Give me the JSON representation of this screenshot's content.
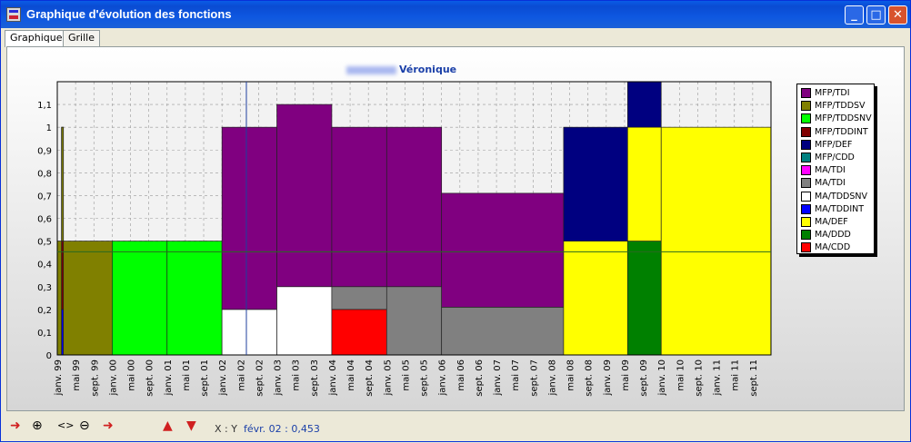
{
  "window": {
    "title": "Graphique d'évolution des fonctions"
  },
  "tabs": [
    "Graphique",
    "Grille"
  ],
  "chart_title": "Véronique",
  "chart_data": {
    "type": "area",
    "y_ticks": [
      "0",
      "0,1",
      "0,2",
      "0,3",
      "0,4",
      "0,5",
      "0,6",
      "0,7",
      "0,8",
      "0,9",
      "1",
      "1,1"
    ],
    "x_ticks": [
      "janv. 99",
      "mai 99",
      "sept. 99",
      "janv. 00",
      "mai 00",
      "sept. 00",
      "janv. 01",
      "mai 01",
      "sept. 01",
      "janv. 02",
      "mai 02",
      "sept. 02",
      "janv. 03",
      "mai 03",
      "sept. 03",
      "janv. 04",
      "mai 04",
      "sept. 04",
      "janv. 05",
      "mai 05",
      "sept. 05",
      "janv. 06",
      "mai 06",
      "sept. 06",
      "janv. 07",
      "mai 07",
      "sept. 07",
      "janv. 08",
      "mai 08",
      "sept. 08",
      "janv. 09",
      "mai 09",
      "sept. 09",
      "janv. 10",
      "mai 10",
      "sept. 10",
      "janv. 11",
      "mai 11",
      "sept. 11"
    ],
    "ylim": [
      0,
      1.2
    ],
    "series": [
      {
        "name": "MFP/TDI",
        "color": "#800080"
      },
      {
        "name": "MFP/TDDSV",
        "color": "#808000"
      },
      {
        "name": "MFP/TDDSNV",
        "color": "#00ff00"
      },
      {
        "name": "MFP/TDDINT",
        "color": "#800000"
      },
      {
        "name": "MFP/DEF",
        "color": "#000080"
      },
      {
        "name": "MFP/CDD",
        "color": "#008080"
      },
      {
        "name": "MA/TDI",
        "color": "#ff00ff"
      },
      {
        "name": "MA/TDI",
        "color": "#808080"
      },
      {
        "name": "MA/TDDSNV",
        "color": "#ffffff"
      },
      {
        "name": "MA/TDDINT",
        "color": "#0000ff"
      },
      {
        "name": "MA/DEF",
        "color": "#ffff00"
      },
      {
        "name": "MA/DDD",
        "color": "#008000"
      },
      {
        "name": "MA/CDD",
        "color": "#ff0000"
      }
    ],
    "segments": [
      {
        "x0": 0,
        "x1": 0.7,
        "stack": [
          {
            "c": 1,
            "v": 0.5
          }
        ]
      },
      {
        "x0": 0.7,
        "x1": 1.0,
        "stack": [
          {
            "c": 9,
            "v": 0.2
          },
          {
            "c": 3,
            "v": 0.3
          },
          {
            "c": 1,
            "v": 0.5
          }
        ]
      },
      {
        "x0": 1.0,
        "x1": 9.0,
        "stack": [
          {
            "c": 1,
            "v": 0.5
          }
        ]
      },
      {
        "x0": 9.0,
        "x1": 18.0,
        "stack": [
          {
            "c": 2,
            "v": 0.5
          }
        ]
      },
      {
        "x0": 18.0,
        "x1": 27.0,
        "stack": [
          {
            "c": 2,
            "v": 0.5
          }
        ]
      },
      {
        "x0": 27.0,
        "x1": 31.0,
        "stack": [
          {
            "c": 8,
            "v": 0.2
          },
          {
            "c": 0,
            "v": 0.8
          }
        ]
      },
      {
        "x0": 31.0,
        "x1": 36.0,
        "stack": [
          {
            "c": 8,
            "v": 0.2
          },
          {
            "c": 0,
            "v": 0.8
          }
        ]
      },
      {
        "x0": 36.0,
        "x1": 45.0,
        "stack": [
          {
            "c": 8,
            "v": 0.3
          },
          {
            "c": 0,
            "v": 0.8
          }
        ]
      },
      {
        "x0": 45.0,
        "x1": 54.0,
        "stack": [
          {
            "c": 12,
            "v": 0.2
          },
          {
            "c": 7,
            "v": 0.1
          },
          {
            "c": 0,
            "v": 0.7
          }
        ]
      },
      {
        "x0": 54.0,
        "x1": 63.0,
        "stack": [
          {
            "c": 7,
            "v": 0.3
          },
          {
            "c": 0,
            "v": 0.7
          }
        ]
      },
      {
        "x0": 63.0,
        "x1": 83.0,
        "stack": [
          {
            "c": 7,
            "v": 0.21
          },
          {
            "c": 0,
            "v": 0.5
          }
        ]
      },
      {
        "x0": 83.0,
        "x1": 93.5,
        "stack": [
          {
            "c": 10,
            "v": 0.5
          },
          {
            "c": 4,
            "v": 0.5
          }
        ]
      },
      {
        "x0": 93.5,
        "x1": 99.0,
        "stack": [
          {
            "c": 11,
            "v": 0.5
          },
          {
            "c": 10,
            "v": 0.5
          },
          {
            "c": 4,
            "v": 0.2
          }
        ]
      },
      {
        "x0": 99.0,
        "x1": 117.0,
        "stack": [
          {
            "c": 10,
            "v": 1.0
          }
        ]
      }
    ],
    "spike": {
      "x0": 0.7,
      "x1": 1.0,
      "c": 1,
      "top": 1.0
    },
    "crosshair": {
      "x": 31.0,
      "y": 0.453
    }
  },
  "bottom": {
    "xy_label": "X : Y",
    "xy_value": "févr. 02 : 0,453",
    "icons": [
      "left-arrow-icon",
      "zoom-in-icon",
      "fit-icon",
      "zoom-out-icon",
      "right-arrow-icon",
      "up-arrow-icon",
      "down-arrow-icon"
    ]
  }
}
